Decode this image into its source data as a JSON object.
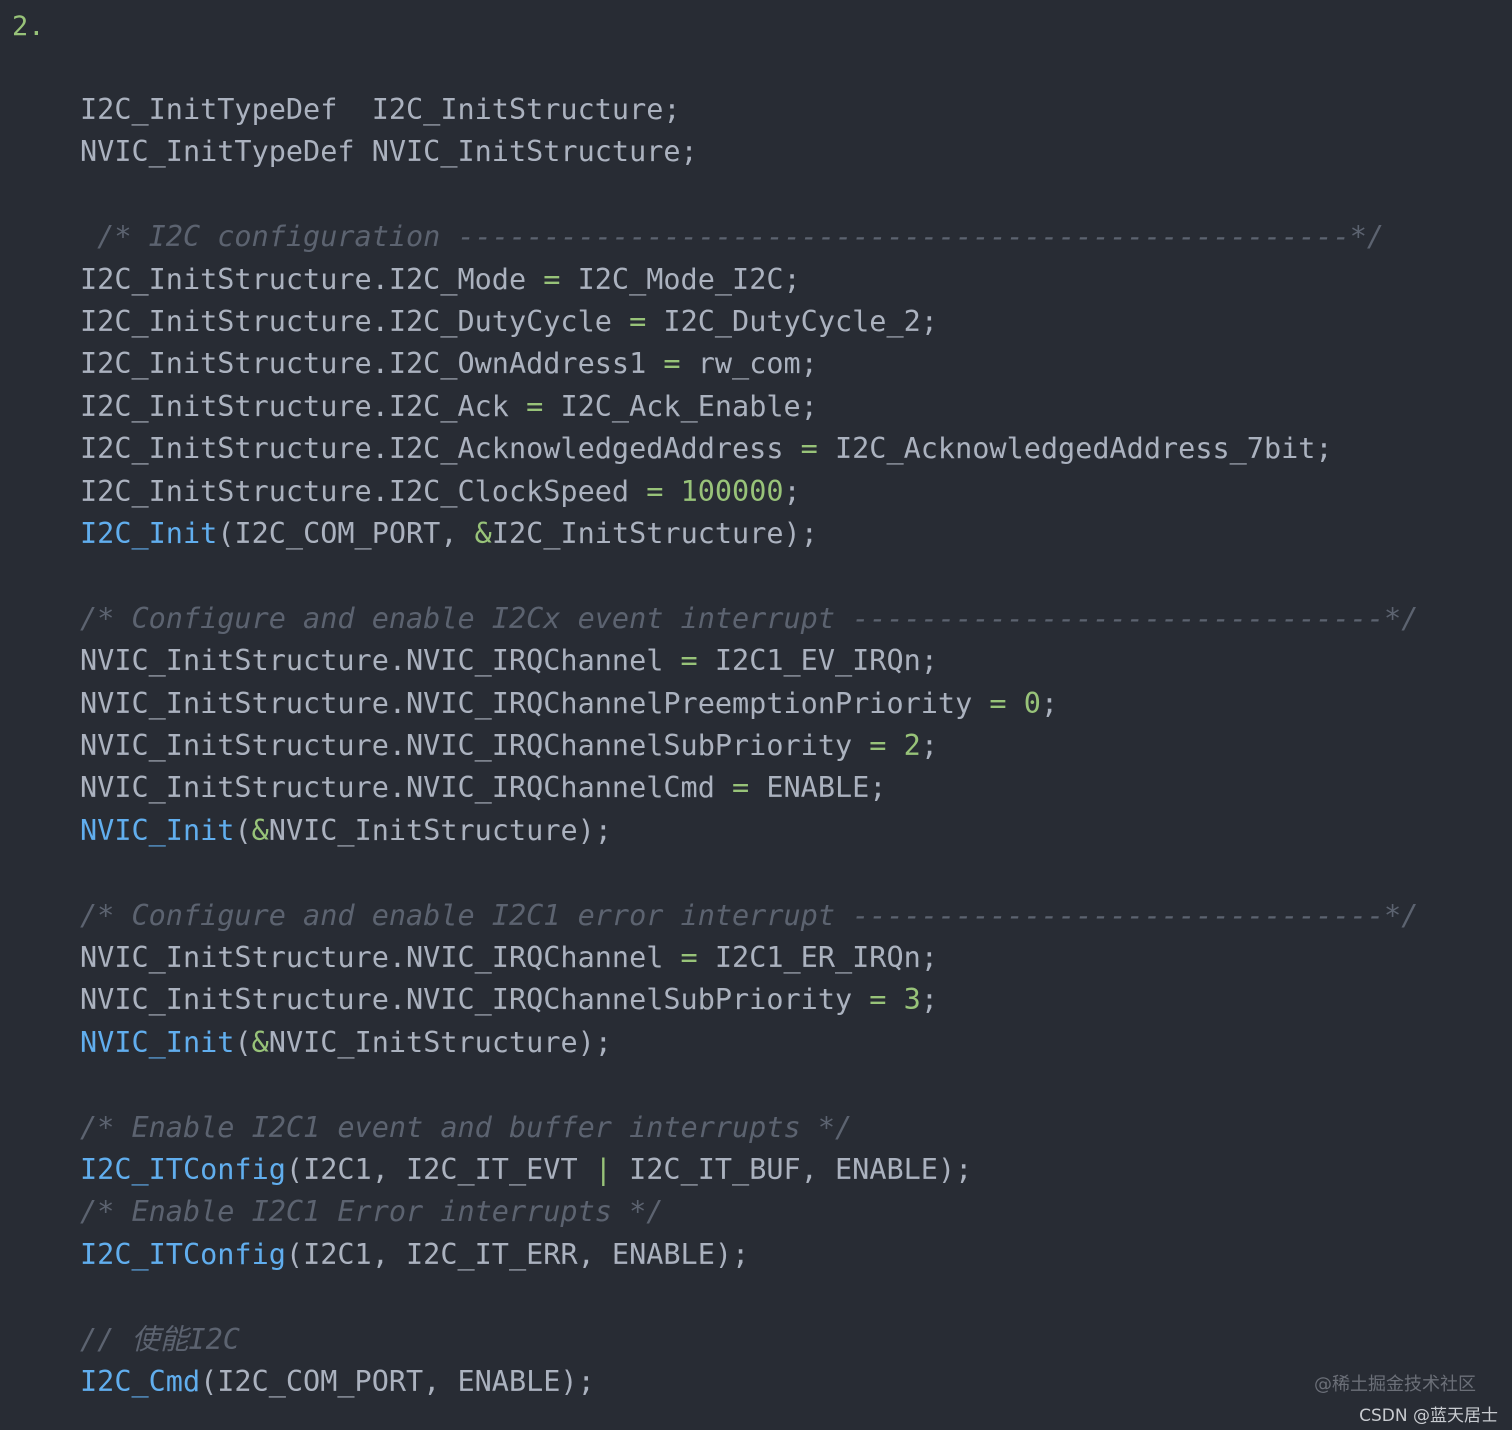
{
  "step_label": "2.",
  "colors": {
    "background": "#282c34",
    "plain": "#abb2bf",
    "function": "#61aeee",
    "number": "#98c379",
    "operator": "#98c379",
    "comment": "#5c6370"
  },
  "code_lines": [
    [
      {
        "t": "I2C_InitTypeDef  I2C_InitStructure;",
        "k": "plain"
      }
    ],
    [
      {
        "t": "NVIC_InitTypeDef NVIC_InitStructure;",
        "k": "plain"
      }
    ],
    [],
    [
      {
        "t": " /* I2C configuration ----------------------------------------------------*/",
        "k": "comment"
      }
    ],
    [
      {
        "t": "I2C_InitStructure.I2C_Mode ",
        "k": "plain"
      },
      {
        "t": "=",
        "k": "op"
      },
      {
        "t": " I2C_Mode_I2C;",
        "k": "plain"
      }
    ],
    [
      {
        "t": "I2C_InitStructure.I2C_DutyCycle ",
        "k": "plain"
      },
      {
        "t": "=",
        "k": "op"
      },
      {
        "t": " I2C_DutyCycle_2;",
        "k": "plain"
      }
    ],
    [
      {
        "t": "I2C_InitStructure.I2C_OwnAddress1 ",
        "k": "plain"
      },
      {
        "t": "=",
        "k": "op"
      },
      {
        "t": " rw_com;",
        "k": "plain"
      }
    ],
    [
      {
        "t": "I2C_InitStructure.I2C_Ack ",
        "k": "plain"
      },
      {
        "t": "=",
        "k": "op"
      },
      {
        "t": " I2C_Ack_Enable;",
        "k": "plain"
      }
    ],
    [
      {
        "t": "I2C_InitStructure.I2C_AcknowledgedAddress ",
        "k": "plain"
      },
      {
        "t": "=",
        "k": "op"
      },
      {
        "t": " I2C_AcknowledgedAddress_7bit;",
        "k": "plain"
      }
    ],
    [
      {
        "t": "I2C_InitStructure.I2C_ClockSpeed ",
        "k": "plain"
      },
      {
        "t": "=",
        "k": "op"
      },
      {
        "t": " ",
        "k": "plain"
      },
      {
        "t": "100000",
        "k": "num"
      },
      {
        "t": ";",
        "k": "plain"
      }
    ],
    [
      {
        "t": "I2C_Init",
        "k": "func"
      },
      {
        "t": "(I2C_COM_PORT, ",
        "k": "plain"
      },
      {
        "t": "&",
        "k": "op"
      },
      {
        "t": "I2C_InitStructure);",
        "k": "plain"
      }
    ],
    [],
    [
      {
        "t": "/* Configure and enable I2Cx event interrupt -------------------------------*/",
        "k": "comment"
      }
    ],
    [
      {
        "t": "NVIC_InitStructure.NVIC_IRQChannel ",
        "k": "plain"
      },
      {
        "t": "=",
        "k": "op"
      },
      {
        "t": " I2C1_EV_IRQn;",
        "k": "plain"
      }
    ],
    [
      {
        "t": "NVIC_InitStructure.NVIC_IRQChannelPreemptionPriority ",
        "k": "plain"
      },
      {
        "t": "=",
        "k": "op"
      },
      {
        "t": " ",
        "k": "plain"
      },
      {
        "t": "0",
        "k": "num"
      },
      {
        "t": ";",
        "k": "plain"
      }
    ],
    [
      {
        "t": "NVIC_InitStructure.NVIC_IRQChannelSubPriority ",
        "k": "plain"
      },
      {
        "t": "=",
        "k": "op"
      },
      {
        "t": " ",
        "k": "plain"
      },
      {
        "t": "2",
        "k": "num"
      },
      {
        "t": ";",
        "k": "plain"
      }
    ],
    [
      {
        "t": "NVIC_InitStructure.NVIC_IRQChannelCmd ",
        "k": "plain"
      },
      {
        "t": "=",
        "k": "op"
      },
      {
        "t": " ENABLE;",
        "k": "plain"
      }
    ],
    [
      {
        "t": "NVIC_Init",
        "k": "func"
      },
      {
        "t": "(",
        "k": "plain"
      },
      {
        "t": "&",
        "k": "op"
      },
      {
        "t": "NVIC_InitStructure);",
        "k": "plain"
      }
    ],
    [],
    [
      {
        "t": "/* Configure and enable I2C1 error interrupt -------------------------------*/",
        "k": "comment"
      }
    ],
    [
      {
        "t": "NVIC_InitStructure.NVIC_IRQChannel ",
        "k": "plain"
      },
      {
        "t": "=",
        "k": "op"
      },
      {
        "t": " I2C1_ER_IRQn;",
        "k": "plain"
      }
    ],
    [
      {
        "t": "NVIC_InitStructure.NVIC_IRQChannelSubPriority ",
        "k": "plain"
      },
      {
        "t": "=",
        "k": "op"
      },
      {
        "t": " ",
        "k": "plain"
      },
      {
        "t": "3",
        "k": "num"
      },
      {
        "t": ";",
        "k": "plain"
      }
    ],
    [
      {
        "t": "NVIC_Init",
        "k": "func"
      },
      {
        "t": "(",
        "k": "plain"
      },
      {
        "t": "&",
        "k": "op"
      },
      {
        "t": "NVIC_InitStructure);",
        "k": "plain"
      }
    ],
    [],
    [
      {
        "t": "/* Enable I2C1 event and buffer interrupts */",
        "k": "comment"
      }
    ],
    [
      {
        "t": "I2C_ITConfig",
        "k": "func"
      },
      {
        "t": "(I2C1, I2C_IT_EVT ",
        "k": "plain"
      },
      {
        "t": "|",
        "k": "op"
      },
      {
        "t": " I2C_IT_BUF, ENABLE);",
        "k": "plain"
      }
    ],
    [
      {
        "t": "/* Enable I2C1 Error interrupts */",
        "k": "comment"
      }
    ],
    [
      {
        "t": "I2C_ITConfig",
        "k": "func"
      },
      {
        "t": "(I2C1, I2C_IT_ERR, ENABLE);",
        "k": "plain"
      }
    ],
    [],
    [
      {
        "t": "// 使能I2C",
        "k": "comment"
      }
    ],
    [
      {
        "t": "I2C_Cmd",
        "k": "func"
      },
      {
        "t": "(I2C_COM_PORT, ENABLE);",
        "k": "plain"
      }
    ]
  ],
  "watermarks": {
    "juejin": "@稀土掘金技术社区",
    "csdn": "CSDN @蓝天居士"
  }
}
